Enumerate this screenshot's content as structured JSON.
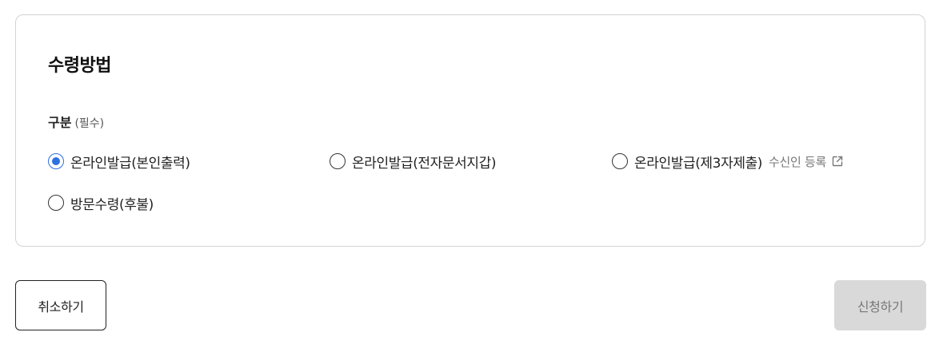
{
  "section": {
    "title": "수령방법",
    "field_label": "구분",
    "field_required": "(필수)"
  },
  "options": [
    {
      "label": "온라인발급(본인출력)",
      "checked": true
    },
    {
      "label": "온라인발급(전자문서지갑)",
      "checked": false
    },
    {
      "label": "온라인발급(제3자제출)",
      "checked": false
    },
    {
      "label": "방문수령(후불)",
      "checked": false
    }
  ],
  "recipient_link": {
    "label": "수신인 등록",
    "icon": "external-link-icon"
  },
  "buttons": {
    "cancel": "취소하기",
    "submit": "신청하기"
  },
  "colors": {
    "accent": "#2f6fe0",
    "disabled_bg": "#d9d9d9",
    "disabled_text": "#777777",
    "border": "#d3d3d3"
  }
}
